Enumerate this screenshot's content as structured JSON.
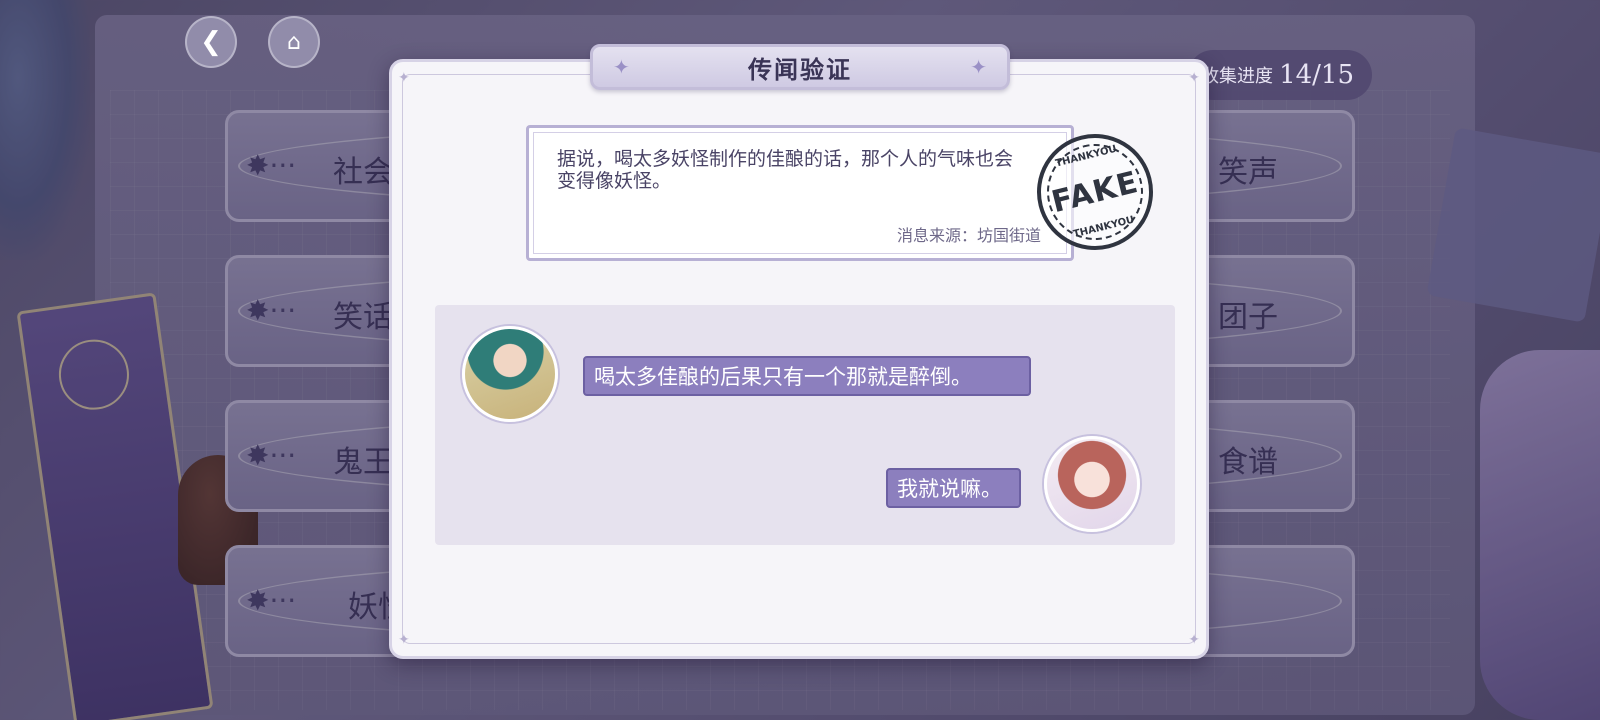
{
  "colors": {
    "modal_bg": "#f6f5f9",
    "bubble": "#8c7fbe",
    "title_text": "#3a3456",
    "stamp_ink": "#2f3440"
  },
  "topbar": {
    "back_icon": "back-arrow-icon",
    "home_icon": "castle-icon",
    "progress_label": "收集进度",
    "progress_value": "14/15"
  },
  "topics": {
    "left": [
      "社会",
      "笑话",
      "鬼王",
      "妖怪"
    ],
    "right": [
      "笑声",
      "团子",
      "食谱",
      ""
    ]
  },
  "modal": {
    "title": "传闻验证",
    "rumor_text": "据说，喝太多妖怪制作的佳酿的话，那个人的气味也会变得像妖怪。",
    "rumor_source": "消息来源：坊国街道",
    "stamp": {
      "word": "FAKE",
      "ring_top": "THANKYOU",
      "ring_bottom": "THANKYOU"
    },
    "chat": [
      {
        "side": "left",
        "text": "喝太多佳酿的后果只有一个那就是醉倒。"
      },
      {
        "side": "right",
        "text": "我就说嘛。"
      }
    ]
  }
}
